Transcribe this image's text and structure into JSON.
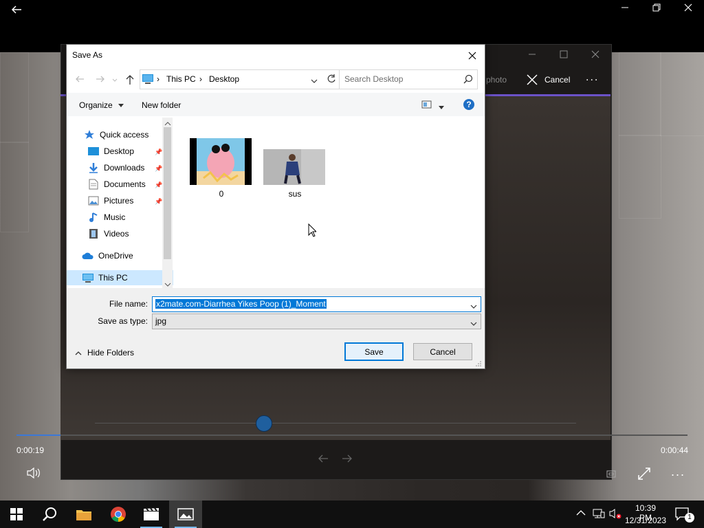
{
  "app": {
    "back_icon": "back-arrow-icon",
    "edit_photo_label": "photo",
    "cancel_label": "Cancel",
    "more_label": "...",
    "time_elapsed": "0:00:19",
    "time_total": "0:00:44",
    "timeline_progress": 0.066,
    "scrub_position": 0.35
  },
  "dialog": {
    "title": "Save As",
    "address": {
      "root": "This PC",
      "folder": "Desktop"
    },
    "search_placeholder": "Search Desktop",
    "toolbar": {
      "organize": "Organize",
      "new_folder": "New folder",
      "help": "?"
    },
    "nav": [
      {
        "label": "Quick access",
        "icon": "star-icon",
        "pinned": false
      },
      {
        "label": "Desktop",
        "icon": "desktop-folder-icon",
        "pinned": true
      },
      {
        "label": "Downloads",
        "icon": "downloads-icon",
        "pinned": true
      },
      {
        "label": "Documents",
        "icon": "documents-icon",
        "pinned": true
      },
      {
        "label": "Pictures",
        "icon": "pictures-icon",
        "pinned": true
      },
      {
        "label": "Music",
        "icon": "music-icon",
        "pinned": false
      },
      {
        "label": "Videos",
        "icon": "videos-icon",
        "pinned": false
      },
      {
        "label": "OneDrive",
        "icon": "cloud-icon",
        "pinned": false
      },
      {
        "label": "This PC",
        "icon": "computer-icon",
        "pinned": false
      }
    ],
    "files": [
      {
        "name": "0",
        "icon": "image-thumbnail-icon"
      },
      {
        "name": "sus",
        "icon": "image-thumbnail-icon"
      }
    ],
    "file_name_label": "File name:",
    "file_name_value": "x2mate.com-Diarrhea Yikes Poop (1)_Moment",
    "save_type_label": "Save as type:",
    "save_type_value": "jpg",
    "hide_folders_label": "Hide Folders",
    "save_button": "Save",
    "cancel_button": "Cancel"
  },
  "taskbar": {
    "time": "10:39 PM",
    "date": "12/31/2023",
    "notification_count": "1"
  },
  "colors": {
    "accent": "#0078d7",
    "editor_accent": "#6b52c8",
    "selection": "#0078d7"
  }
}
